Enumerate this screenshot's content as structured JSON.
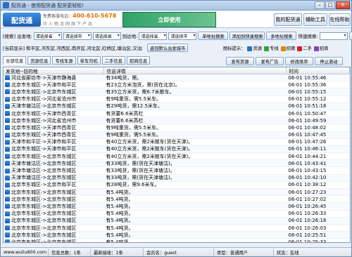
{
  "window": {
    "title": "配货通 - 使用配货通 配货更轻松!"
  },
  "banner": {
    "logo": "配货通",
    "hotline_label": "免费客服电话：",
    "hotline_number": "400-610-5678",
    "slogan": "华人物流网旗下产品",
    "ad_text": "立即使用",
    "buttons": [
      "我的配货通",
      "辅助工具",
      "在线帮助"
    ]
  },
  "search": {
    "label_search": "[搜索]",
    "label_from": "出发地:",
    "label_to": "到达地:",
    "placeholder_province": "请选择省",
    "placeholder_city": "请选择市",
    "placeholder_county": "请选择县",
    "btn_single": "单地址搜索",
    "btn_add": "添加到快速搜索",
    "btn_multi": "多地址搜索",
    "label_quick": "快速搜索:",
    "btn_quick": "搜索"
  },
  "location": {
    "label": "[当前显示]",
    "text": "和平区,河东区,河西区,南开区,河北区,红桥区,塘沽区,汉沽区",
    "btn_reset": "返回默认出发城市"
  },
  "legend": {
    "label": "图标提示：",
    "items": [
      {
        "name": "货源",
        "color": "#2a6fc0"
      },
      {
        "name": "专线",
        "color": "#2fa33b"
      },
      {
        "name": "招聘",
        "color": "#e08a00"
      },
      {
        "name": "二手",
        "color": "#d02020"
      },
      {
        "name": "招商",
        "color": "#8a3fc0"
      }
    ]
  },
  "tabs": [
    "全部信息",
    "货源信息",
    "专线车源",
    "单车司机",
    "二手信息",
    "招商信息"
  ],
  "actions": [
    "发布货源",
    "发布广告",
    "修改排序",
    "停止滚动"
  ],
  "grid": {
    "headers": [
      "发货地--目的地",
      "信息详情",
      "时间"
    ],
    "rows": [
      {
        "route": "河北省廊坊市->天津市静海县",
        "detail": "有34吨货，需。",
        "time": "06-01 10:55:46"
      },
      {
        "route": "北京市东城区->天津市和平区",
        "detail": "有23立方米泡货，需(货在北京)。",
        "time": "06-01 10:55:36"
      },
      {
        "route": "北京市东城区->北京市东城区",
        "detail": "有35立方米货，需6.7米敞车。",
        "time": "06-01 10:55:15"
      },
      {
        "route": "北京市东城区->河北省沧州市",
        "detail": "有9吨重货，需5.5米车。",
        "time": "06-01 10:55:12"
      },
      {
        "route": "天津市塘沽区->北京市东城区",
        "detail": "有29吨货，需12.5米车。",
        "time": "06-01 10:51:18"
      },
      {
        "route": "北京市东城区->天津市西青区",
        "detail": "有货要6.6米高栏",
        "time": "06-01 10:50:47"
      },
      {
        "route": "北京市东城区->河北省沧州市",
        "detail": "有货要6.6米高栏",
        "time": "06-01 10:49:59"
      },
      {
        "route": "北京市东城区->天津市西青区",
        "detail": "有9吨重货，需5.5米车。",
        "time": "06-01 10:48:02"
      },
      {
        "route": "北京市东城区->天津市西青区",
        "detail": "有9吨重货，需5.5米车。",
        "time": "06-01 10:47:45"
      },
      {
        "route": "天津市和平区->天津市和平区",
        "detail": "有40立方米货，需2米敞车(货在天津)。",
        "time": "06-01 10:47:26"
      },
      {
        "route": "北京市东城区->天津市和平区",
        "detail": "有40立方米货，需2米敞车(货在天津)。",
        "time": "06-01 10:46:11"
      },
      {
        "route": "北京市东城区->北京市东城区",
        "detail": "有40立方米货，需2米敞车(货在天津)。",
        "time": "06-01 10:44:21"
      },
      {
        "route": "天津市塘沽区->北京市东城区",
        "detail": "有33吨货，需(货在天津塘沽)。",
        "time": "06-01 10:43:41"
      },
      {
        "route": "天津市塘沽区->北京市东城区",
        "detail": "有33吨货，需(货在天津塘沽)。",
        "time": "06-01 10:43:15"
      },
      {
        "route": "天津市塘沽区->北京市东城区",
        "detail": "有33吨货，需(货在天津塘沽)。",
        "time": "06-01 10:42:10"
      },
      {
        "route": "北京市东城区->北京市和平区",
        "detail": "有28吨货，需9.6米车。",
        "time": "06-01 10:38:12"
      },
      {
        "route": "北京市东城区->北京市东城区",
        "detail": "有5.4吨货。",
        "time": "06-01 10:27:23"
      },
      {
        "route": "北京市东城区->北京市东城区",
        "detail": "有5.4吨货。",
        "time": "06-01 10:27:02"
      },
      {
        "route": "北京市东城区->北京市东城区",
        "detail": "有5.4吨货。",
        "time": "06-01 10:26:45"
      },
      {
        "route": "北京市东城区->北京市东城区",
        "detail": "有5.4吨货。",
        "time": "06-01 10:26:33"
      },
      {
        "route": "北京市东城区->北京市东城区",
        "detail": "有5.4吨货。",
        "time": "06-01 10:26:18"
      },
      {
        "route": "北京市东城区->北京市东城区",
        "detail": "有5.4吨货。",
        "time": "06-01 10:26:03"
      },
      {
        "route": "北京市东城区->北京市东城区",
        "detail": "有5.4吨货。",
        "time": "06-01 10:25:51"
      },
      {
        "route": "北京市东城区->北京市东城区",
        "detail": "有5.4吨货。",
        "time": "06-01 10:25:33"
      }
    ]
  },
  "status": {
    "site": "www.wuliu800.com",
    "info_total": "信息总数：1条",
    "latest_recv": "最新接收：1条",
    "member": "会员名：guest",
    "member_type": "类型：普通用户",
    "state": "状态：在线"
  }
}
